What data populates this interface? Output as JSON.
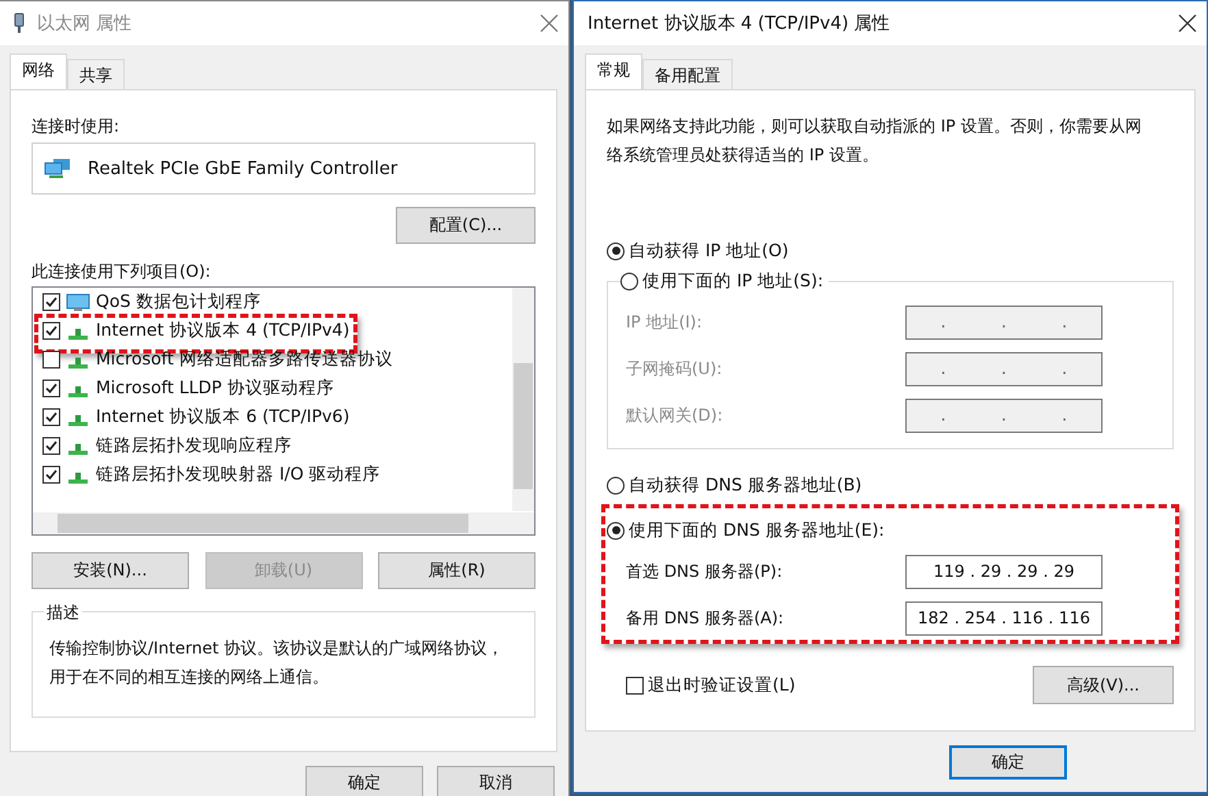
{
  "left_window": {
    "title": "以太网 属性",
    "tabs": [
      {
        "label": "网络",
        "selected": true
      },
      {
        "label": "共享",
        "selected": false
      }
    ],
    "connect_using_label": "连接时使用:",
    "adapter": "Realtek PCIe GbE Family Controller",
    "configure_button": "配置(C)...",
    "items_label": "此连接使用下列项目(O):",
    "items": [
      {
        "kind": "service",
        "label": "QoS 数据包计划程序",
        "checked": true,
        "highlighted": false
      },
      {
        "kind": "protocol",
        "label": "Internet 协议版本 4 (TCP/IPv4)",
        "checked": true,
        "highlighted": true
      },
      {
        "kind": "protocol",
        "label": "Microsoft 网络适配器多路传送器协议",
        "checked": false,
        "highlighted": false
      },
      {
        "kind": "protocol",
        "label": "Microsoft LLDP 协议驱动程序",
        "checked": true,
        "highlighted": false
      },
      {
        "kind": "protocol",
        "label": "Internet 协议版本 6 (TCP/IPv6)",
        "checked": true,
        "highlighted": false
      },
      {
        "kind": "protocol",
        "label": "链路层拓扑发现响应程序",
        "checked": true,
        "highlighted": false
      },
      {
        "kind": "protocol",
        "label": "链路层拓扑发现映射器 I/O 驱动程序",
        "checked": true,
        "highlighted": false
      }
    ],
    "action_buttons": [
      {
        "label": "安装(N)...",
        "disabled": false
      },
      {
        "label": "卸载(U)",
        "disabled": true
      },
      {
        "label": "属性(R)",
        "disabled": false
      }
    ],
    "description": {
      "title": "描述",
      "text": "传输控制协议/Internet 协议。该协议是默认的广域网络协议，用于在不同的相互连接的网络上通信。"
    },
    "buttons": [
      "确定",
      "取消"
    ]
  },
  "right_window": {
    "title": "Internet 协议版本 4 (TCP/IPv4) 属性",
    "tabs": [
      {
        "label": "常规",
        "selected": true
      },
      {
        "label": "备用配置",
        "selected": false
      }
    ],
    "intro": "如果网络支持此功能，则可以获取自动指派的 IP 设置。否则，你需要从网络系统管理员处获得适当的 IP 设置。",
    "ip_auto": {
      "label": "自动获得 IP 地址(O)",
      "selected": true
    },
    "ip_manual": {
      "label": "使用下面的 IP 地址(S):",
      "selected": false
    },
    "ip_fields": [
      {
        "label": "IP 地址(I):",
        "value": ". . .",
        "disabled": true
      },
      {
        "label": "子网掩码(U):",
        "value": ". . .",
        "disabled": true
      },
      {
        "label": "默认网关(D):",
        "value": ". . .",
        "disabled": true
      }
    ],
    "dns_auto": {
      "label": "自动获得 DNS 服务器地址(B)",
      "selected": false
    },
    "dns_manual": {
      "label": "使用下面的 DNS 服务器地址(E):",
      "selected": true,
      "highlighted": true
    },
    "dns_fields": [
      {
        "label": "首选 DNS 服务器(P):",
        "value": "119 . 29 . 29 . 29",
        "disabled": false
      },
      {
        "label": "备用 DNS 服务器(A):",
        "value": "182 . 254 . 116 . 116",
        "disabled": false
      }
    ],
    "validate": {
      "label": "退出时验证设置(L)",
      "checked": false
    },
    "advanced_button": "高级(V)...",
    "buttons": [
      "确定"
    ]
  }
}
